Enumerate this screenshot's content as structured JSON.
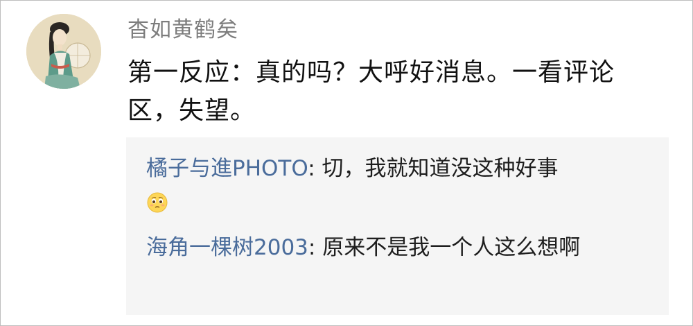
{
  "post": {
    "username": "杳如黄鹤矣",
    "content": "第一反应：真的吗？大呼好消息。一看评论区，失望。"
  },
  "replies": [
    {
      "name": "橘子与進PHOTO",
      "separator": ": ",
      "text": "切，我就知道没这种好事",
      "emoji": "pleading-face-emoji"
    },
    {
      "name": "海角一棵树2003",
      "separator": ": ",
      "text": "原来不是我一个人这么想啊"
    }
  ],
  "colors": {
    "username": "#7d7d7d",
    "reply_name": "#4a6c9b",
    "reply_background": "#f5f5f5",
    "body_text": "#111111"
  }
}
